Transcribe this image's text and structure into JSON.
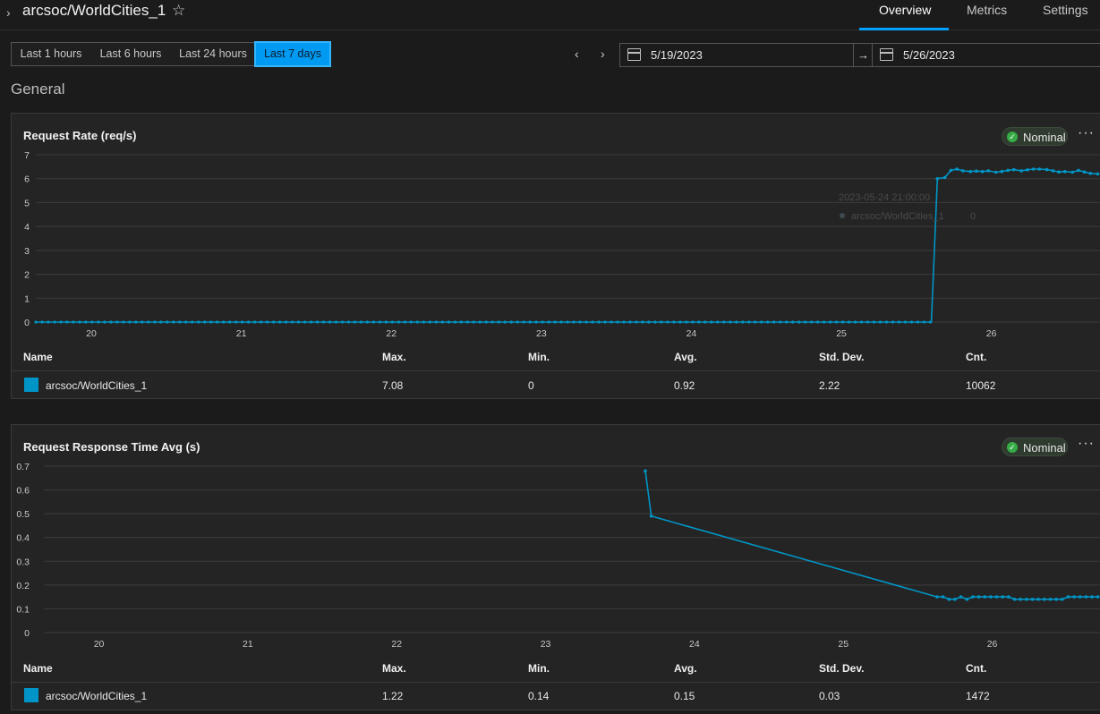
{
  "header": {
    "title": "arcsoc/WorldCities_1",
    "tabs": [
      {
        "label": "Overview",
        "active": true
      },
      {
        "label": "Metrics",
        "active": false
      },
      {
        "label": "Settings",
        "active": false
      }
    ]
  },
  "time_range": {
    "options": [
      "Last 1 hours",
      "Last 6 hours",
      "Last 24 hours",
      "Last 7 days"
    ],
    "selected": "Last 7 days",
    "start_date": "5/19/2023",
    "end_date": "5/26/2023",
    "arrow": "→"
  },
  "section_title": "General",
  "colors": {
    "accent": "#00a0ff",
    "series": "#0095c6",
    "nominal": "#35ac46"
  },
  "cards": [
    {
      "title": "Request Rate (req/s)",
      "status": "Nominal",
      "tooltip": {
        "time": "2023-05-24 21:00:00",
        "series": "arcsoc/WorldCities_1",
        "value": "0"
      },
      "table": {
        "headers": [
          "Name",
          "Max.",
          "Min.",
          "Avg.",
          "Std. Dev.",
          "Cnt."
        ],
        "row": [
          "arcsoc/WorldCities_1",
          "7.08",
          "0",
          "0.92",
          "2.22",
          "10062"
        ]
      }
    },
    {
      "title": "Request Response Time Avg (s)",
      "status": "Nominal",
      "table": {
        "headers": [
          "Name",
          "Max.",
          "Min.",
          "Avg.",
          "Std. Dev.",
          "Cnt."
        ],
        "row": [
          "arcsoc/WorldCities_1",
          "1.22",
          "0.14",
          "0.15",
          "0.03",
          "1472"
        ]
      }
    }
  ],
  "chart_data": [
    {
      "type": "line",
      "title": "Request Rate (req/s)",
      "x_ticks": [
        "20",
        "21",
        "22",
        "23",
        "24",
        "25",
        "26"
      ],
      "y_ticks": [
        "0",
        "1",
        "2",
        "3",
        "4",
        "5",
        "6",
        "7"
      ],
      "xlim": [
        19.63,
        26.73
      ],
      "ylim": [
        0,
        7
      ],
      "grid": true,
      "series": [
        {
          "name": "arcsoc/WorldCities_1",
          "x": [
            19.63,
            25.6,
            25.64,
            25.69,
            25.73,
            25.77,
            25.81,
            25.86,
            25.9,
            25.94,
            25.98,
            26.03,
            26.07,
            26.11,
            26.15,
            26.2,
            26.24,
            26.28,
            26.32,
            26.37,
            26.41,
            26.45,
            26.49,
            26.54,
            26.58,
            26.62,
            26.66,
            26.71
          ],
          "y": [
            0,
            0,
            6.0,
            6.05,
            6.35,
            6.4,
            6.33,
            6.3,
            6.32,
            6.3,
            6.33,
            6.27,
            6.3,
            6.35,
            6.38,
            6.33,
            6.37,
            6.4,
            6.4,
            6.38,
            6.33,
            6.28,
            6.3,
            6.27,
            6.35,
            6.28,
            6.22,
            6.2
          ]
        }
      ]
    },
    {
      "type": "line",
      "title": "Request Response Time Avg (s)",
      "x_ticks": [
        "20",
        "21",
        "22",
        "23",
        "24",
        "25",
        "26"
      ],
      "y_ticks": [
        "0",
        "0.1",
        "0.2",
        "0.3",
        "0.4",
        "0.5",
        "0.6",
        "0.7"
      ],
      "xlim": [
        19.63,
        26.73
      ],
      "ylim": [
        0,
        0.7
      ],
      "grid": true,
      "series": [
        {
          "name": "arcsoc/WorldCities_1",
          "x": [
            23.67,
            23.71,
            25.63,
            25.67,
            25.71,
            25.75,
            25.79,
            25.83,
            25.87,
            25.91,
            25.95,
            25.99,
            26.03,
            26.07,
            26.11,
            26.15,
            26.19,
            26.23,
            26.27,
            26.31,
            26.35,
            26.39,
            26.43,
            26.47,
            26.51,
            26.55,
            26.59,
            26.63,
            26.67,
            26.71
          ],
          "y": [
            0.68,
            0.49,
            0.15,
            0.15,
            0.14,
            0.14,
            0.15,
            0.14,
            0.15,
            0.15,
            0.15,
            0.15,
            0.15,
            0.15,
            0.15,
            0.14,
            0.14,
            0.14,
            0.14,
            0.14,
            0.14,
            0.14,
            0.14,
            0.14,
            0.15,
            0.15,
            0.15,
            0.15,
            0.15,
            0.15
          ]
        }
      ]
    }
  ]
}
